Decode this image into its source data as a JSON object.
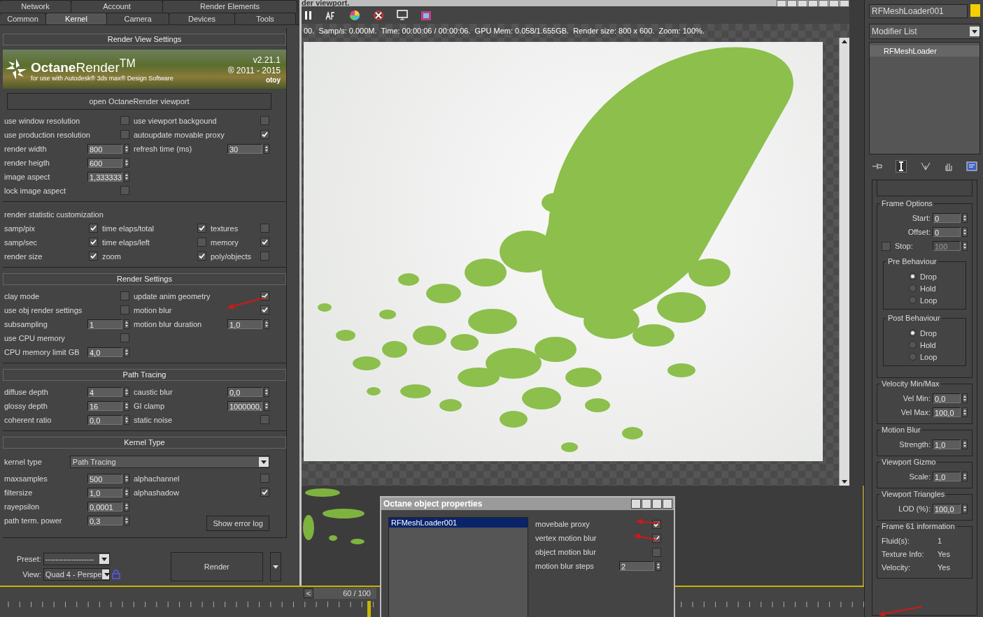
{
  "render_setup": {
    "tab_rows": [
      [
        {
          "label": "Network",
          "selected": false
        },
        {
          "label": "Account",
          "selected": false
        },
        {
          "label": "Render Elements",
          "selected": false
        }
      ],
      [
        {
          "label": "Common",
          "selected": false
        },
        {
          "label": "Kernel",
          "selected": true
        },
        {
          "label": "Camera",
          "selected": false
        },
        {
          "label": "Devices",
          "selected": false
        },
        {
          "label": "Tools",
          "selected": false
        }
      ]
    ],
    "sections": [
      {
        "title": "Render View Settings",
        "banner": {
          "title": "**Octane**Render$^{TM}$",
          "tagline": "for use with Autodesk® 3ds max® Design Software",
          "version": "v2.21.1",
          "copyright": "® 2011 - 2015",
          "brand": "otoy"
        },
        "button": "open OctaneRender viewport",
        "rows": [
          [
            {
              "kind": "checkbox",
              "label": "use window resolution",
              "checked": false
            },
            {
              "kind": "checkbox",
              "label": "use viewport backgound",
              "checked": false
            }
          ],
          [
            {
              "kind": "checkbox",
              "label": "use production resolution",
              "checked": false
            },
            {
              "kind": "checkbox",
              "label": "autoupdate movable proxy",
              "checked": true
            }
          ],
          [
            {
              "kind": "spinner",
              "label": "render width",
              "value": "800"
            },
            {
              "kind": "spinner",
              "label": "refresh time (ms)",
              "value": "30"
            }
          ],
          [
            {
              "kind": "spinner",
              "label": "render heigth",
              "value": "600"
            }
          ],
          [
            {
              "kind": "spinner",
              "label": "image aspect",
              "value": "1,333333"
            }
          ],
          [
            {
              "kind": "checkbox",
              "label": "lock image aspect",
              "checked": false
            }
          ]
        ]
      },
      {
        "heading": "render statistic customization",
        "rows": [
          [
            {
              "kind": "checkbox",
              "label": "samp/pix",
              "checked": true
            },
            {
              "kind": "checkbox",
              "label": "time elaps/total",
              "checked": true
            },
            {
              "kind": "checkbox",
              "label": "textures",
              "checked": false
            }
          ],
          [
            {
              "kind": "checkbox",
              "label": "samp/sec",
              "checked": true
            },
            {
              "kind": "checkbox",
              "label": "time elaps/left",
              "checked": false
            },
            {
              "kind": "checkbox",
              "label": "memory",
              "checked": true
            }
          ],
          [
            {
              "kind": "checkbox",
              "label": "render size",
              "checked": true
            },
            {
              "kind": "checkbox",
              "label": "zoom",
              "checked": true
            },
            {
              "kind": "checkbox",
              "label": "poly/objects",
              "checked": false
            }
          ]
        ]
      },
      {
        "title": "Render Settings",
        "rows": [
          [
            {
              "kind": "checkbox",
              "label": "clay mode",
              "checked": false
            },
            {
              "kind": "checkbox",
              "label": "update anim geometry",
              "checked": true
            }
          ],
          [
            {
              "kind": "checkbox",
              "label": "use obj render settings",
              "checked": false
            },
            {
              "kind": "checkbox",
              "label": "motion blur",
              "checked": true
            }
          ],
          [
            {
              "kind": "spinner",
              "label": "subsampling",
              "value": "1"
            },
            {
              "kind": "spinner",
              "label": "motion blur duration",
              "value": "1,0"
            }
          ],
          [
            {
              "kind": "checkbox",
              "label": "use CPU memory",
              "checked": false
            }
          ],
          [
            {
              "kind": "spinner",
              "label": "CPU memory limit GB",
              "value": "4,0"
            }
          ]
        ]
      },
      {
        "title": "Path Tracing",
        "rows": [
          [
            {
              "kind": "spinner",
              "label": "diffuse depth",
              "value": "4"
            },
            {
              "kind": "spinner",
              "label": "caustic blur",
              "value": "0,0"
            }
          ],
          [
            {
              "kind": "spinner",
              "label": "glossy depth",
              "value": "16"
            },
            {
              "kind": "spinner",
              "label": "GI clamp",
              "value": "1000000,"
            }
          ],
          [
            {
              "kind": "spinner",
              "label": "coherent ratio",
              "value": "0,0"
            },
            {
              "kind": "checkbox",
              "label": "static noise",
              "checked": false
            }
          ]
        ]
      },
      {
        "title": "Kernel Type",
        "rows": [
          [
            {
              "kind": "dropdown",
              "label": "kernel type",
              "value": "Path Tracing"
            }
          ],
          [
            {
              "kind": "spinner",
              "label": "maxsamples",
              "value": "500"
            },
            {
              "kind": "checkbox",
              "label": "alphachannel",
              "checked": false
            }
          ],
          [
            {
              "kind": "spinner",
              "label": "filtersize",
              "value": "1,0"
            },
            {
              "kind": "checkbox",
              "label": "alphashadow",
              "checked": true
            }
          ],
          [
            {
              "kind": "spinner",
              "label": "rayepsilon",
              "value": "0,0001"
            }
          ],
          [
            {
              "kind": "spinner",
              "label": "path term. power",
              "value": "0,3"
            },
            {
              "kind": "button",
              "label": "Show error log"
            }
          ]
        ]
      }
    ],
    "preset": {
      "label": "Preset:",
      "value": "-------------------"
    },
    "view": {
      "label": "View:",
      "value": "Quad 4 - Perspe"
    },
    "render_button": "Render"
  },
  "viewport": {
    "title": "der viewport.",
    "status": "00.  Samp/s: 0.000M.  Time: 00:00:06 / 00:00:06.  GPU Mem: 0.058/1.655GB.  Render size: 800 x 600.  Zoom: 100%."
  },
  "timeline": {
    "prev": "<",
    "frame": "60 / 100"
  },
  "object_properties": {
    "title": "Octane object properties",
    "objects": [
      {
        "label": "RFMeshLoader001",
        "selected": true
      }
    ],
    "rows": [
      {
        "kind": "checkbox",
        "label": "movebale proxy",
        "checked": true
      },
      {
        "kind": "checkbox",
        "label": "vertex motion blur",
        "checked": true
      },
      {
        "kind": "checkbox",
        "label": "object motion blur",
        "checked": false
      },
      {
        "kind": "spinner",
        "label": "motion blur steps",
        "value": "2"
      }
    ]
  },
  "command_panel": {
    "object_name": "RFMeshLoader001",
    "modifier_list": "Modifier List",
    "stack": [
      {
        "label": "RFMeshLoader",
        "selected": true
      }
    ],
    "groups": [
      {
        "title": "Frame Options",
        "rows": [
          {
            "kind": "spinner",
            "label": "Start:",
            "value": "0"
          },
          {
            "kind": "spinner",
            "label": "Offset:",
            "value": "0"
          },
          {
            "kind": "check_spinner",
            "label": "Stop:",
            "checked": false,
            "value": "100",
            "disabled": true
          }
        ],
        "subgroups": [
          {
            "title": "Pre Behaviour",
            "options": [
              {
                "label": "Drop",
                "selected": true
              },
              {
                "label": "Hold",
                "selected": false
              },
              {
                "label": "Loop",
                "selected": false
              }
            ]
          },
          {
            "title": "Post Behaviour",
            "options": [
              {
                "label": "Drop",
                "selected": true
              },
              {
                "label": "Hold",
                "selected": false
              },
              {
                "label": "Loop",
                "selected": false
              }
            ]
          }
        ]
      },
      {
        "title": "Velocity Min/Max",
        "rows": [
          {
            "kind": "spinner",
            "label": "Vel Min:",
            "value": "0,0"
          },
          {
            "kind": "spinner",
            "label": "Vel Max:",
            "value": "100,0"
          }
        ]
      },
      {
        "title": "Motion Blur",
        "rows": [
          {
            "kind": "spinner",
            "label": "Strength:",
            "value": "1,0"
          }
        ]
      },
      {
        "title": "Viewport Gizmo",
        "rows": [
          {
            "kind": "spinner",
            "label": "Scale:",
            "value": "1,0"
          }
        ]
      },
      {
        "title": "Viewport Triangles",
        "rows": [
          {
            "kind": "spinner",
            "label": "LOD (%):",
            "value": "100,0"
          }
        ]
      },
      {
        "title": "Frame 61 information",
        "rows": [
          {
            "kind": "info",
            "label": "Fluid(s):",
            "value": "1"
          },
          {
            "kind": "info",
            "label": "Texture Info:",
            "value": "Yes"
          },
          {
            "kind": "info",
            "label": "Velocity:",
            "value": "Yes"
          }
        ]
      }
    ]
  }
}
